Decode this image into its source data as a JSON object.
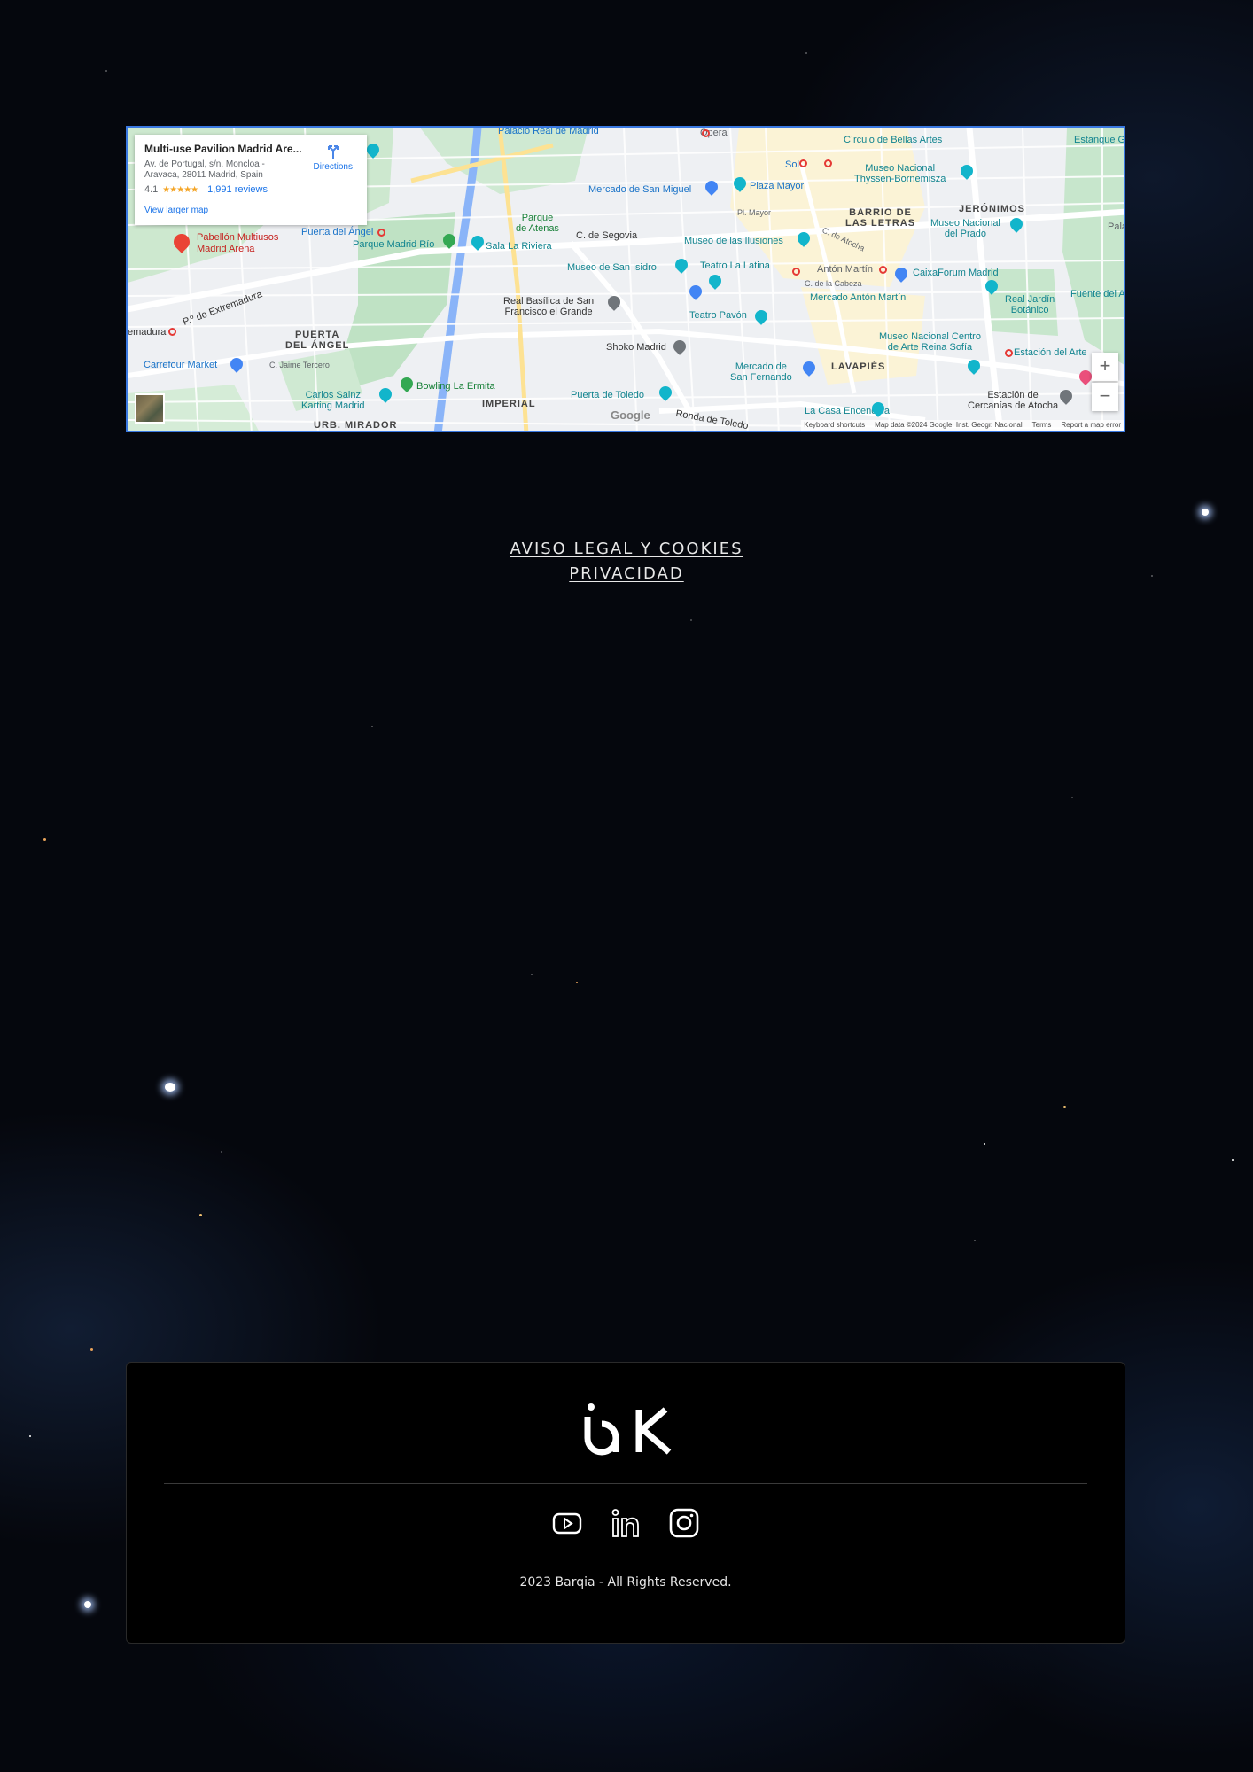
{
  "map": {
    "card": {
      "title": "Multi-use Pavilion Madrid Are...",
      "address": "Av. de Portugal, s/n, Moncloa - Aravaca, 28011 Madrid, Spain",
      "rating": "4.1",
      "stars": "★★★★★",
      "reviews": "1,991 reviews",
      "larger_map": "View larger map",
      "directions": "Directions"
    },
    "labels": {
      "opera": "Ópera",
      "palacio": "Palacio Real de Madrid",
      "circulo": "Círculo de Bellas Artes",
      "estanque": "Estanque G",
      "sol": "Sol",
      "thyssen": "Museo Nacional\nThyssen-Bornemisza",
      "mercado_sm": "Mercado de San Miguel",
      "plaza_mayor": "Plaza Mayor",
      "p_mayor": "Pl. Mayor",
      "barrio_letras": "BARRIO DE\nLAS LETRAS",
      "jeronimos": "JERÓNIMOS",
      "prado": "Museo Nacional\ndel Prado",
      "palac": "Palac",
      "parque_atenas": "Parque\nde Atenas",
      "puerta_angel": "Puerta del Ángel",
      "parque_rio": "Parque Madrid Río",
      "sala_riviera": "Sala La Riviera",
      "segovia": "C. de Segovia",
      "ilusiones": "Museo de las Ilusiones",
      "san_isidro": "Museo de San Isidro",
      "teatro_latina": "Teatro La Latina",
      "anton_martin": "Antón Martín",
      "caixaforum": "CaixaForum Madrid",
      "jardin_botanico": "Real Jardín\nBotánico",
      "fuente_arte": "Fuente del A",
      "basilica": "Real Basílica de San\nFrancisco el Grande",
      "mercado_am": "Mercado Antón Martín",
      "teatro_pavon": "Teatro Pavón",
      "pabellon": "Pabellón Multiusos\nMadrid Arena",
      "p_extremadura": "P.º de Extremadura",
      "extremadura": "emadura",
      "puerta_angel_dist": "PUERTA\nDEL ÁNGEL",
      "shoko": "Shoko Madrid",
      "reina_sofia": "Museo Nacional Centro\nde Arte Reina Sofía",
      "estacion_arte": "Estación del Arte",
      "carrefour": "Carrefour Market",
      "jaime_tercero": "C. Jaime Tercero",
      "mercado_sf": "Mercado de\nSan Fernando",
      "lavapies": "LAVAPIÉS",
      "carlos_sainz": "Carlos Sainz\nKarting Madrid",
      "bowling": "Bowling La Ermita",
      "puerta_toledo": "Puerta de Toledo",
      "imperial": "IMPERIAL",
      "encendida": "La Casa Encendida",
      "cercanias": "Estación de\nCercanías de Atocha",
      "mirador": "URB. MIRADOR",
      "ronda_toledo": "Ronda de Toledo",
      "c_atocha": "C. de Atocha",
      "c_cabeza": "C. de la Cabeza"
    },
    "zoom_in": "+",
    "zoom_out": "−",
    "google": "Google",
    "attribution": [
      "Keyboard shortcuts",
      "Map data ©2024 Google, Inst. Geogr. Nacional",
      "Terms",
      "Report a map error"
    ]
  },
  "links": {
    "legal": "AVISO LEGAL Y COOKIES",
    "privacy": "PRIVACIDAD"
  },
  "footer": {
    "copyright": "2023 Barqia - All Rights Reserved.",
    "social": [
      "youtube-icon",
      "linkedin-icon",
      "instagram-icon"
    ]
  }
}
